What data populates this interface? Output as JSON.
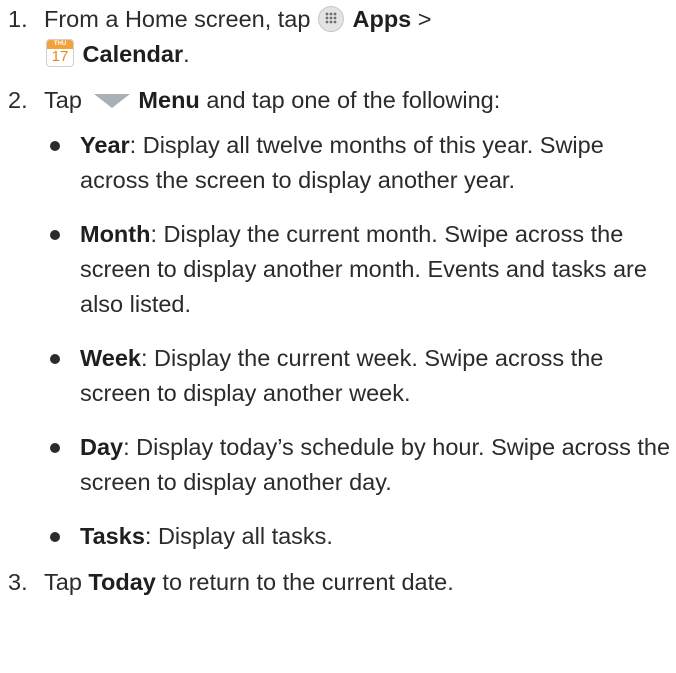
{
  "steps": [
    {
      "number": "1.",
      "text_1": "From a Home screen, tap",
      "apps_label": "Apps",
      "sep": ">",
      "calendar_label": "Calendar",
      "period": "."
    },
    {
      "number": "2.",
      "text_1": "Tap",
      "menu_label": "Menu",
      "text_2": "and tap one of the following:"
    },
    {
      "number": "3.",
      "text_1": "Tap",
      "today_label": "Today",
      "text_2": "to return to the current date."
    }
  ],
  "icons": {
    "apps": "apps-grid-icon",
    "calendar": "calendar-icon",
    "calendar_day": "THU",
    "calendar_date": "17",
    "menu": "menu-triangle-icon"
  },
  "views": [
    {
      "name": "Year",
      "description": ": Display all twelve months of this year. Swipe across the screen to display another year."
    },
    {
      "name": "Month",
      "description": ": Display the current month. Swipe across the screen to display another month. Events and tasks are also listed."
    },
    {
      "name": "Week",
      "description": ": Display the current week. Swipe across the screen to display another week."
    },
    {
      "name": "Day",
      "description": ": Display today’s schedule by hour. Swipe across the screen to display another day."
    },
    {
      "name": "Tasks",
      "description": ": Display all tasks."
    }
  ],
  "colors": {
    "text": "#2b2b2b",
    "calendar_accent": "#f3a33b",
    "menu_triangle": "#a9b0b6"
  }
}
